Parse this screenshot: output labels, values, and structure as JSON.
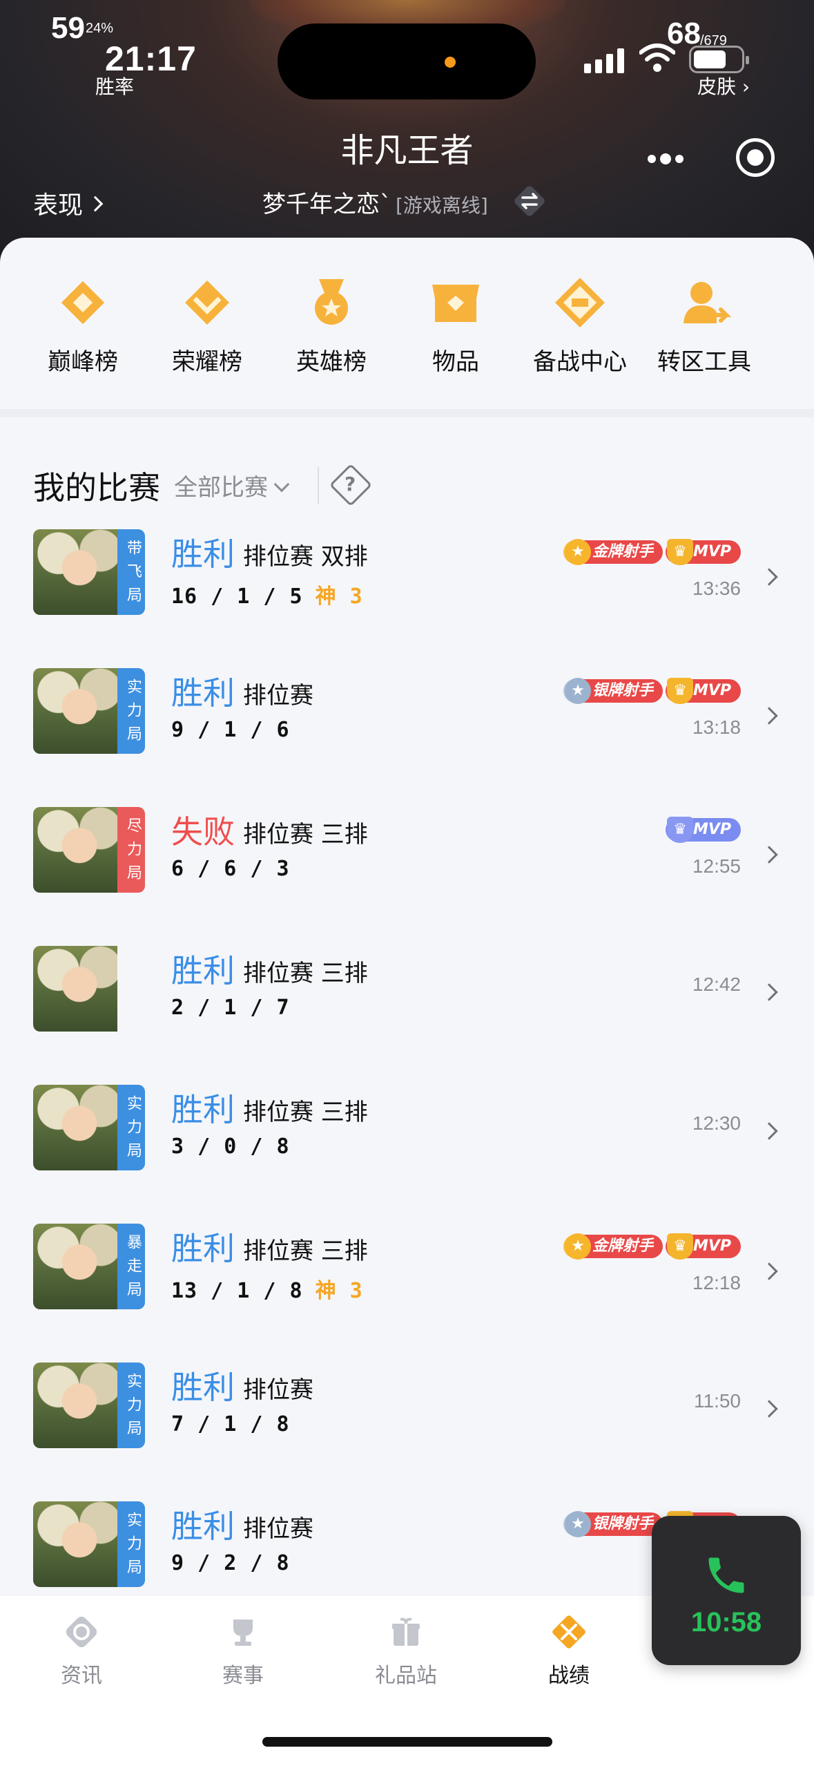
{
  "status_bar": {
    "time": "21:17",
    "win_rate_number": "59",
    "win_rate_suffix": "24%",
    "win_rate_label": "胜率",
    "skin_number": "68",
    "skin_suffix": "/679",
    "skin_label": "皮肤 ›"
  },
  "header": {
    "title": "非凡王者",
    "performance_link": "表现",
    "account_name": "梦千年之恋`",
    "account_status": "[游戏离线]"
  },
  "quick_menu": [
    {
      "label": "巅峰榜",
      "icon": "peak-rank-icon"
    },
    {
      "label": "荣耀榜",
      "icon": "glory-rank-icon"
    },
    {
      "label": "英雄榜",
      "icon": "hero-rank-icon"
    },
    {
      "label": "物品",
      "icon": "items-icon"
    },
    {
      "label": "备战中心",
      "icon": "prep-center-icon"
    },
    {
      "label": "转区工具",
      "icon": "transfer-tool-icon"
    }
  ],
  "matches_section": {
    "title": "我的比赛",
    "filter": "全部比赛"
  },
  "matches": [
    {
      "tag": "带飞局",
      "tag_color": "#3d8fe0",
      "result": "胜利",
      "win": true,
      "mode": "排位赛 双排",
      "kda": "16 / 1 / 5",
      "god": "神 3",
      "badges": [
        {
          "type": "gold",
          "text": "金牌射手"
        },
        {
          "type": "mvp",
          "text": "MVP"
        }
      ],
      "time": "13:36"
    },
    {
      "tag": "实力局",
      "tag_color": "#3d8fe0",
      "result": "胜利",
      "win": true,
      "mode": "排位赛",
      "kda": "9 / 1 / 6",
      "god": "",
      "badges": [
        {
          "type": "silver",
          "text": "银牌射手"
        },
        {
          "type": "mvp",
          "text": "MVP"
        }
      ],
      "time": "13:18"
    },
    {
      "tag": "尽力局",
      "tag_color": "#ea5a5a",
      "result": "失败",
      "win": false,
      "mode": "排位赛 三排",
      "kda": "6 / 6 / 3",
      "god": "",
      "badges": [
        {
          "type": "mvp-blue",
          "text": "MVP"
        }
      ],
      "time": "12:55"
    },
    {
      "tag": "",
      "tag_color": "",
      "result": "胜利",
      "win": true,
      "mode": "排位赛 三排",
      "kda": "2 / 1 / 7",
      "god": "",
      "badges": [],
      "time": "12:42"
    },
    {
      "tag": "实力局",
      "tag_color": "#3d8fe0",
      "result": "胜利",
      "win": true,
      "mode": "排位赛 三排",
      "kda": "3 / 0 / 8",
      "god": "",
      "badges": [],
      "time": "12:30"
    },
    {
      "tag": "暴走局",
      "tag_color": "#3d8fe0",
      "result": "胜利",
      "win": true,
      "mode": "排位赛 三排",
      "kda": "13 / 1 / 8",
      "god": "神 3",
      "badges": [
        {
          "type": "gold",
          "text": "金牌射手"
        },
        {
          "type": "mvp",
          "text": "MVP"
        }
      ],
      "time": "12:18"
    },
    {
      "tag": "实力局",
      "tag_color": "#3d8fe0",
      "result": "胜利",
      "win": true,
      "mode": "排位赛",
      "kda": "7 / 1 / 8",
      "god": "",
      "badges": [],
      "time": "11:50"
    },
    {
      "tag": "实力局",
      "tag_color": "#3d8fe0",
      "result": "胜利",
      "win": true,
      "mode": "排位赛",
      "kda": "9 / 2 / 8",
      "god": "",
      "badges": [
        {
          "type": "silver",
          "text": "银牌射手"
        },
        {
          "type": "mvp",
          "text": "MVP"
        }
      ],
      "time": ""
    }
  ],
  "tabbar": [
    {
      "label": "资讯",
      "icon": "news-icon",
      "active": false
    },
    {
      "label": "赛事",
      "icon": "trophy-icon",
      "active": false
    },
    {
      "label": "礼品站",
      "icon": "gift-icon",
      "active": false
    },
    {
      "label": "战绩",
      "icon": "record-icon",
      "active": true
    }
  ],
  "call": {
    "duration": "10:58"
  },
  "colors": {
    "win": "#3a8ee6",
    "lose": "#ef4e4e",
    "accent": "#f5a623",
    "call_green": "#28c25b"
  }
}
